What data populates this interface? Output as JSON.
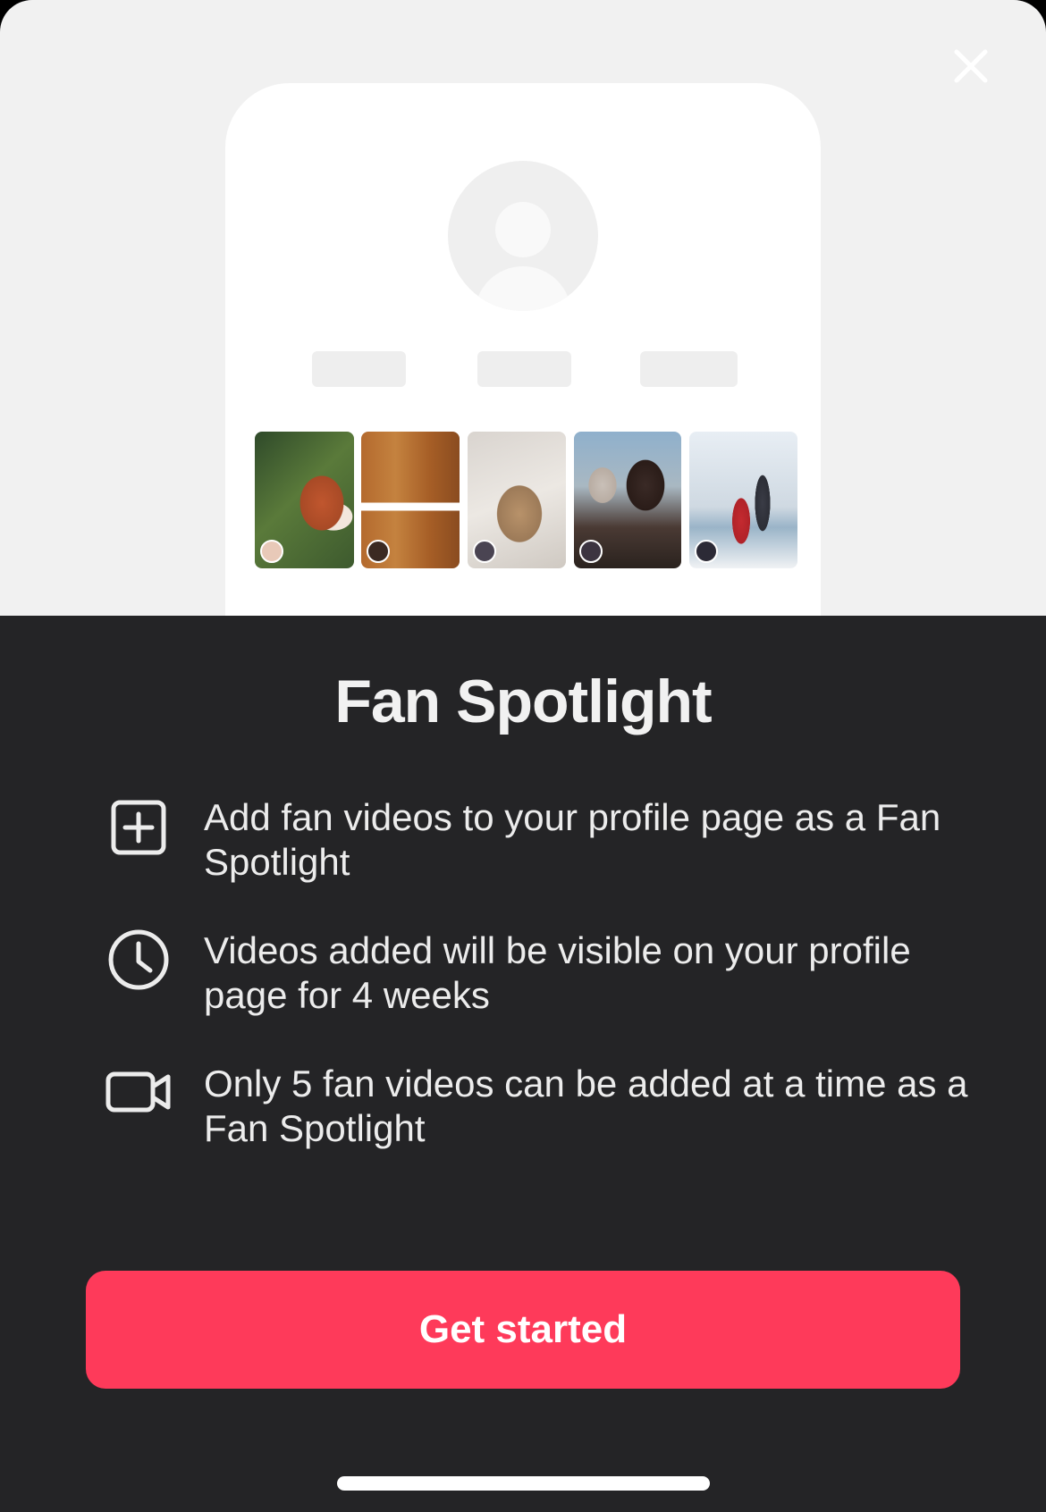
{
  "dialog": {
    "title": "Fan Spotlight",
    "close_icon": "close-icon",
    "features": [
      {
        "icon": "add-square-icon",
        "text": "Add fan videos to your profile page as a Fan Spotlight"
      },
      {
        "icon": "clock-icon",
        "text": "Videos added will be visible on your profile page for 4 weeks"
      },
      {
        "icon": "video-camera-icon",
        "text": "Only 5 fan videos can be added at a time as a Fan Spotlight"
      }
    ],
    "cta_label": "Get started"
  },
  "illustration": {
    "placeholder_avatar_icon": "user-placeholder-icon",
    "thumbnails": [
      "red-panda",
      "cookie-baking",
      "terrier-dog",
      "street-musicians",
      "couple-with-dog"
    ]
  },
  "colors": {
    "hero_background": "#f1f1f1",
    "sheet_background": "#242426",
    "accent": "#fe3a5a",
    "text": "#ececec"
  }
}
